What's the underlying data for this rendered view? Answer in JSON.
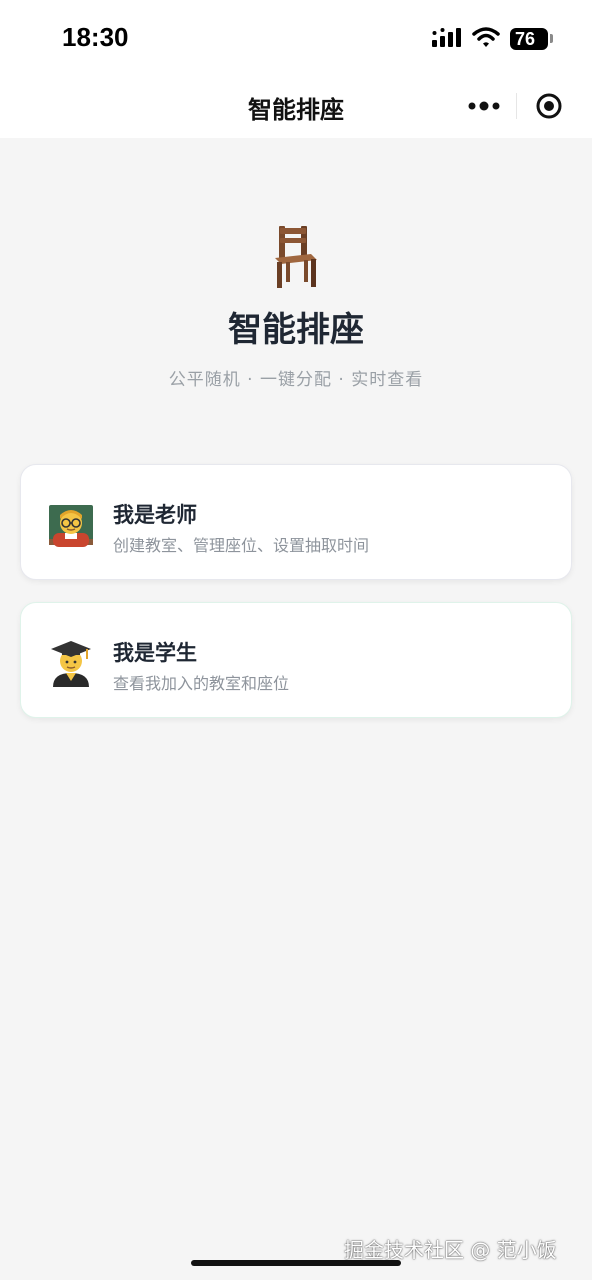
{
  "status_bar": {
    "time": "18:30",
    "battery": "76",
    "icons": [
      "signal-icon",
      "wifi-icon",
      "battery-icon"
    ]
  },
  "nav": {
    "title": "智能排座",
    "menu_icons": [
      "more-dots-icon",
      "close-target-icon"
    ]
  },
  "hero": {
    "icon": "chair-icon",
    "title": "智能排座",
    "subtitle": "公平随机 · 一键分配 · 实时查看"
  },
  "roles": [
    {
      "icon": "teacher-icon",
      "title": "我是老师",
      "description": "创建教室、管理座位、设置抽取时间"
    },
    {
      "icon": "student-icon",
      "title": "我是学生",
      "description": "查看我加入的教室和座位"
    }
  ],
  "watermark": "掘金技术社区 @ 范小饭",
  "colors": {
    "background": "#f5f5f5",
    "card": "#ffffff",
    "title": "#1f2733",
    "muted": "#8e949c"
  }
}
